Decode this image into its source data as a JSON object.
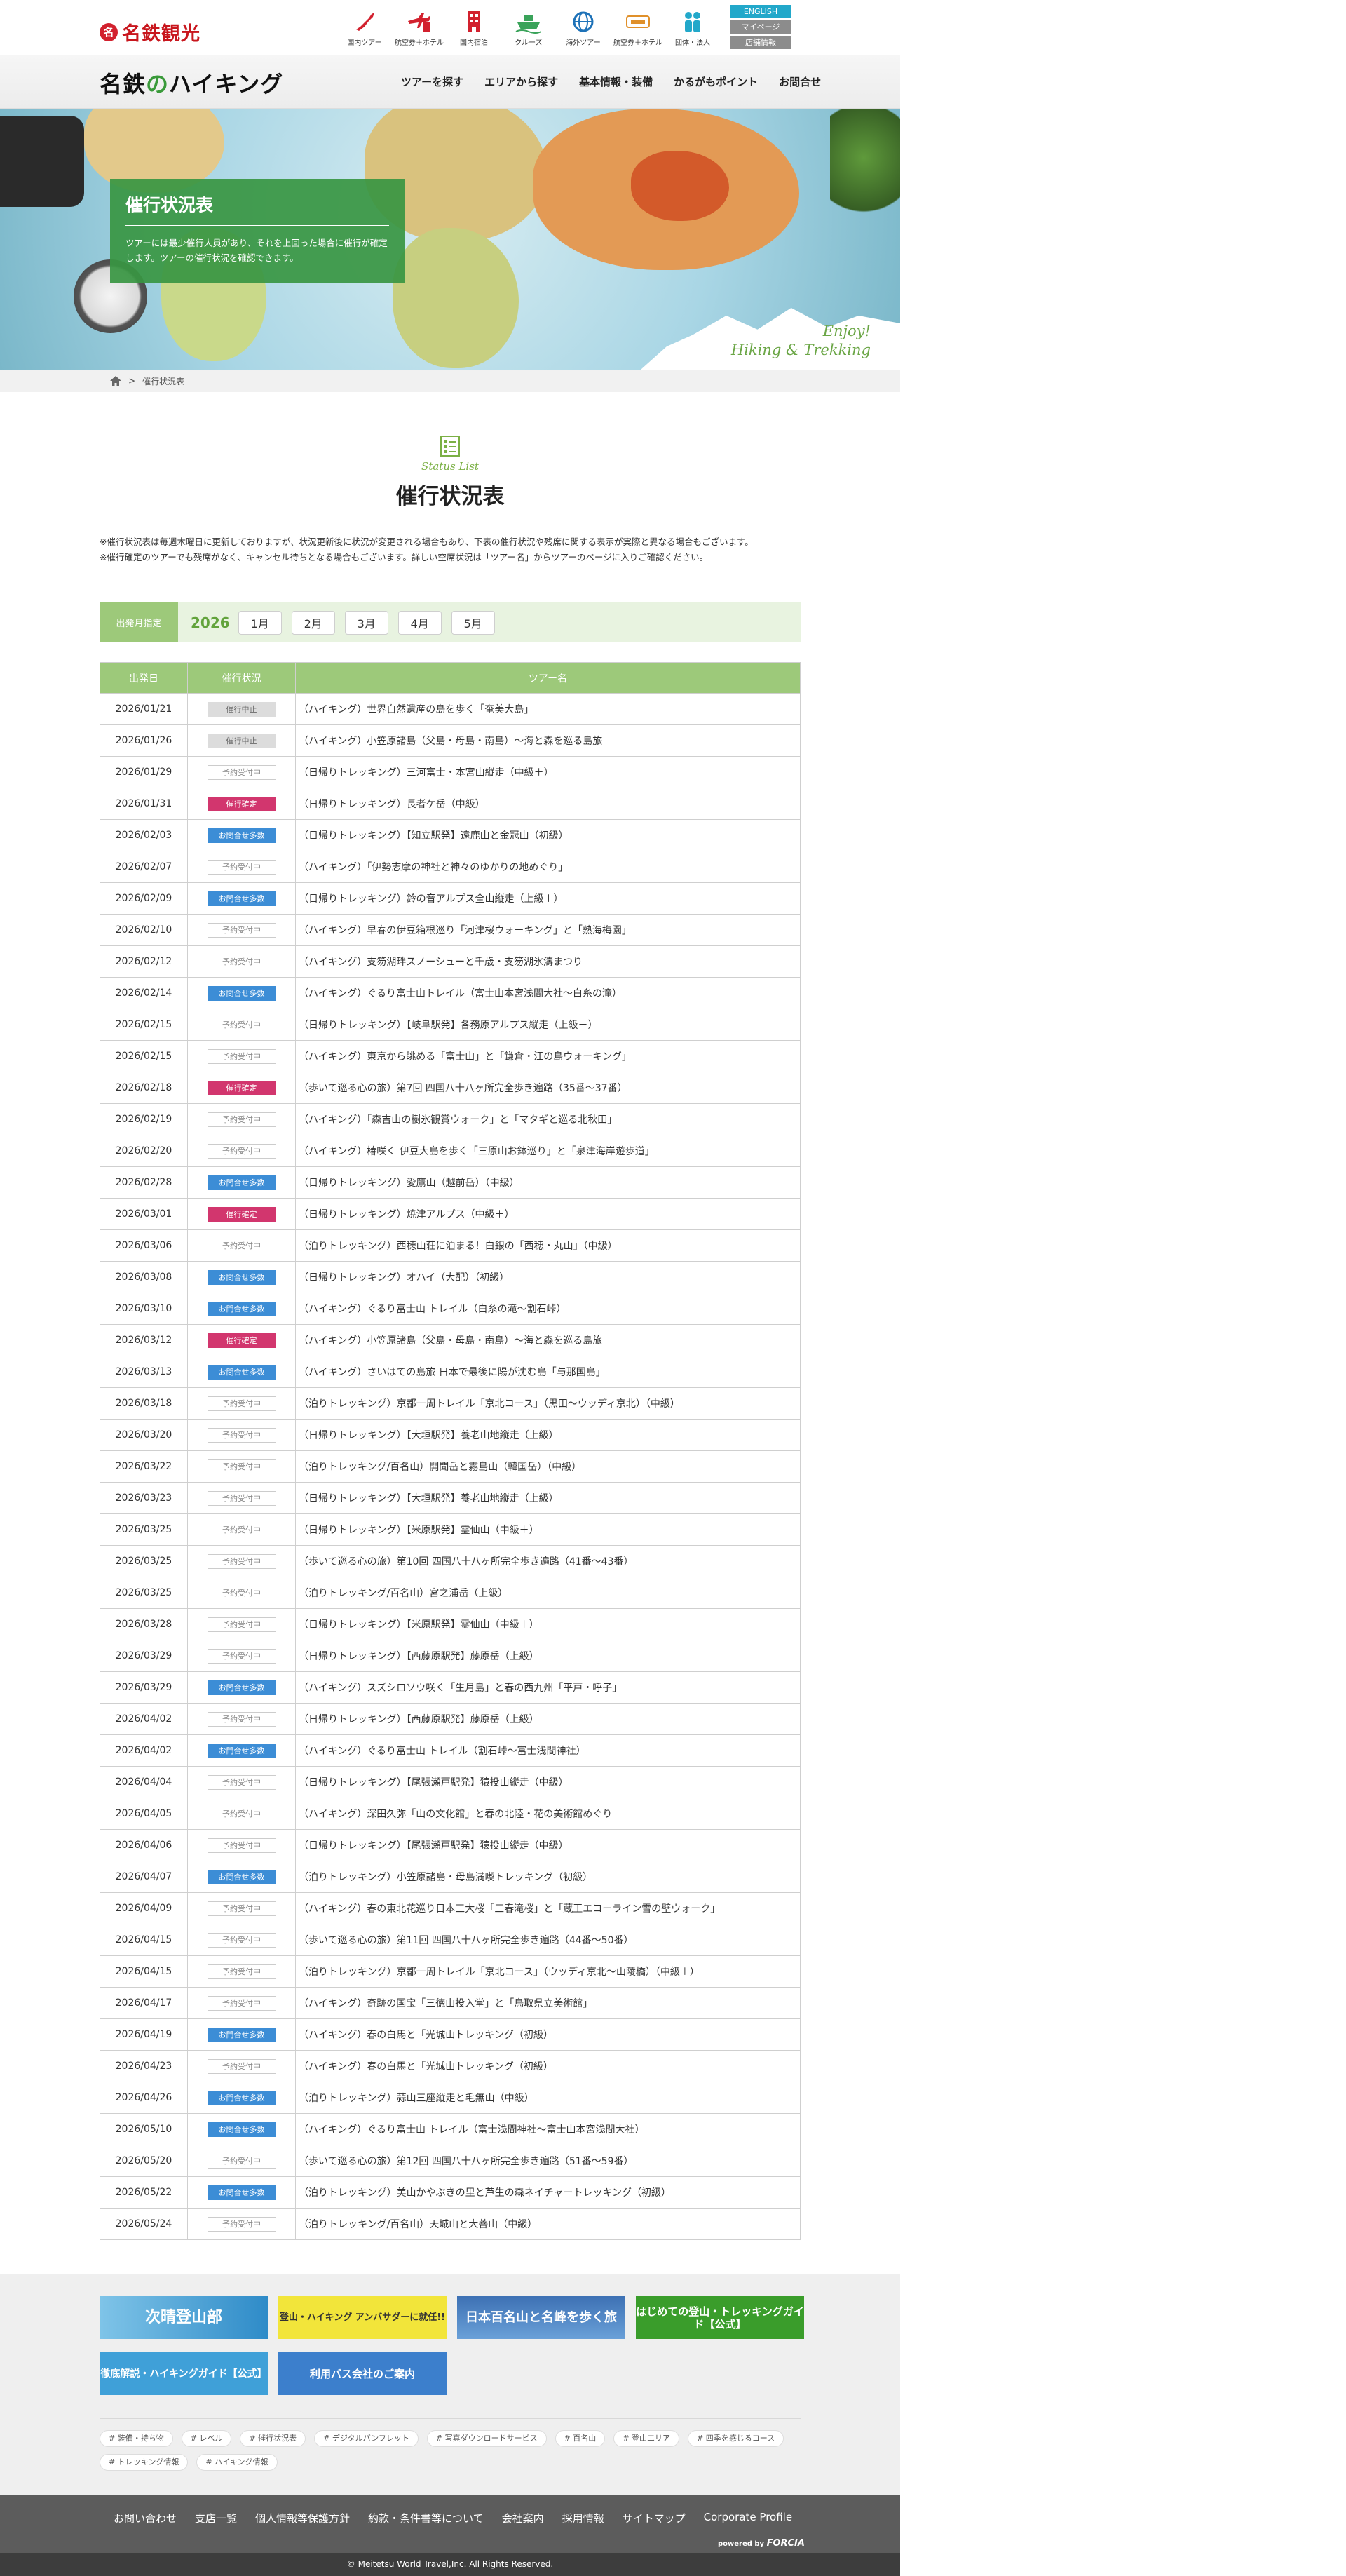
{
  "brand": {
    "mark": "名",
    "name": "名鉄観光"
  },
  "services": [
    {
      "label": "国内ツアー",
      "icon": "japan-map-icon"
    },
    {
      "label": "航空券＋ホテル",
      "icon": "plane-hotel-icon"
    },
    {
      "label": "国内宿泊",
      "icon": "building-icon"
    },
    {
      "label": "クルーズ",
      "icon": "ship-icon"
    },
    {
      "label": "海外ツアー",
      "icon": "globe-icon"
    },
    {
      "label": "航空券＋ホテル",
      "icon": "tabipad-icon"
    },
    {
      "label": "団体・法人",
      "icon": "group-icon"
    }
  ],
  "utility": {
    "english": "ENGLISH",
    "mypage": "マイページ",
    "stores": "店舗情報"
  },
  "site_logo": {
    "main": "名鉄",
    "kana": "の",
    "rest": "ハイキング"
  },
  "nav": [
    "ツアーを探す",
    "エリアから探す",
    "基本情報・装備",
    "かるがもポイント",
    "お問合せ"
  ],
  "hero": {
    "title": "催行状況表",
    "text": "ツアーには最少催行人員があり、それを上回った場合に催行が確定します。ツアーの催行状況を確認できます。",
    "tagline1": "Enjoy!",
    "tagline2": "Hiking & Trekking"
  },
  "breadcrumb": {
    "current": "催行状況表"
  },
  "section": {
    "en": "Status List",
    "title": "催行状況表"
  },
  "notes": [
    "※催行状況表は毎週木曜日に更新しておりますが、状況更新後に状況が変更される場合もあり、下表の催行状況や残席に関する表示が実際と異なる場合もございます。",
    "※催行確定のツアーでも残席がなく、キャンセル待ちとなる場合もございます。詳しい空席状況は「ツアー名」からツアーのページに入りご確認ください。"
  ],
  "filter": {
    "label": "出発月指定",
    "year": "2026",
    "months": [
      "1月",
      "2月",
      "3月",
      "4月",
      "5月"
    ]
  },
  "table": {
    "headers": [
      "出発日",
      "催行状況",
      "ツアー名"
    ],
    "rows": [
      {
        "date": "2026/01/21",
        "status": "催行中止",
        "type": "stop",
        "name": "（ハイキング）世界自然遺産の島を歩く「奄美大島」"
      },
      {
        "date": "2026/01/26",
        "status": "催行中止",
        "type": "stop",
        "name": "（ハイキング）小笠原諸島（父島・母島・南島）～海と森を巡る島旅"
      },
      {
        "date": "2026/01/29",
        "status": "予約受付中",
        "type": "open",
        "name": "（日帰りトレッキング）三河富士・本宮山縦走（中級＋）"
      },
      {
        "date": "2026/01/31",
        "status": "催行確定",
        "type": "confirm",
        "name": "（日帰りトレッキング）長者ケ岳（中級）"
      },
      {
        "date": "2026/02/03",
        "status": "お問合せ多数",
        "type": "inquiry",
        "name": "（日帰りトレッキング）【知立駅発】遠鹿山と金冠山（初級）"
      },
      {
        "date": "2026/02/07",
        "status": "予約受付中",
        "type": "open",
        "name": "（ハイキング）「伊勢志摩の神社と神々のゆかりの地めぐり」"
      },
      {
        "date": "2026/02/09",
        "status": "お問合せ多数",
        "type": "inquiry",
        "name": "（日帰りトレッキング）鈴の音アルプス全山縦走（上級＋）"
      },
      {
        "date": "2026/02/10",
        "status": "予約受付中",
        "type": "open",
        "name": "（ハイキング）早春の伊豆箱根巡り「河津桜ウォーキング」と「熱海梅園」"
      },
      {
        "date": "2026/02/12",
        "status": "予約受付中",
        "type": "open",
        "name": "（ハイキング）支笏湖畔スノーシューと千歳・支笏湖氷濤まつり"
      },
      {
        "date": "2026/02/14",
        "status": "お問合せ多数",
        "type": "inquiry",
        "name": "（ハイキング）ぐるり富士山トレイル（富士山本宮浅間大社～白糸の滝）"
      },
      {
        "date": "2026/02/15",
        "status": "予約受付中",
        "type": "open",
        "name": "（日帰りトレッキング）【岐阜駅発】各務原アルプス縦走（上級＋）"
      },
      {
        "date": "2026/02/15",
        "status": "予約受付中",
        "type": "open",
        "name": "（ハイキング）東京から眺める「富士山」と「鎌倉・江の島ウォーキング」"
      },
      {
        "date": "2026/02/18",
        "status": "催行確定",
        "type": "confirm",
        "name": "（歩いて巡る心の旅）第7回 四国八十八ヶ所完全歩き遍路（35番～37番）"
      },
      {
        "date": "2026/02/19",
        "status": "予約受付中",
        "type": "open",
        "name": "（ハイキング）「森吉山の樹氷観賞ウォーク」と「マタギと巡る北秋田」"
      },
      {
        "date": "2026/02/20",
        "status": "予約受付中",
        "type": "open",
        "name": "（ハイキング）椿咲く 伊豆大島を歩く「三原山お鉢巡り」と「泉津海岸遊歩道」"
      },
      {
        "date": "2026/02/28",
        "status": "お問合せ多数",
        "type": "inquiry",
        "name": "（日帰りトレッキング）愛鷹山（越前岳）（中級）"
      },
      {
        "date": "2026/03/01",
        "status": "催行確定",
        "type": "confirm",
        "name": "（日帰りトレッキング）焼津アルプス（中級＋）"
      },
      {
        "date": "2026/03/06",
        "status": "予約受付中",
        "type": "open",
        "name": "（泊りトレッキング）西穂山荘に泊まる！白銀の「西穂・丸山」（中級）"
      },
      {
        "date": "2026/03/08",
        "status": "お問合せ多数",
        "type": "inquiry",
        "name": "（日帰りトレッキング）オハイ（大配）（初級）"
      },
      {
        "date": "2026/03/10",
        "status": "お問合せ多数",
        "type": "inquiry",
        "name": "（ハイキング）ぐるり富士山 トレイル（白糸の滝～割石峠）"
      },
      {
        "date": "2026/03/12",
        "status": "催行確定",
        "type": "confirm",
        "name": "（ハイキング）小笠原諸島（父島・母島・南島）～海と森を巡る島旅"
      },
      {
        "date": "2026/03/13",
        "status": "お問合せ多数",
        "type": "inquiry",
        "name": "（ハイキング）さいはての島旅 日本で最後に陽が沈む島「与那国島」"
      },
      {
        "date": "2026/03/18",
        "status": "予約受付中",
        "type": "open",
        "name": "（泊りトレッキング）京都一周トレイル「京北コース」（黒田～ウッディ京北）（中級）"
      },
      {
        "date": "2026/03/20",
        "status": "予約受付中",
        "type": "open",
        "name": "（日帰りトレッキング）【大垣駅発】養老山地縦走（上級）"
      },
      {
        "date": "2026/03/22",
        "status": "予約受付中",
        "type": "open",
        "name": "（泊りトレッキング/百名山）開聞岳と霧島山（韓国岳）（中級）"
      },
      {
        "date": "2026/03/23",
        "status": "予約受付中",
        "type": "open",
        "name": "（日帰りトレッキング）【大垣駅発】養老山地縦走（上級）"
      },
      {
        "date": "2026/03/25",
        "status": "予約受付中",
        "type": "open",
        "name": "（日帰りトレッキング）【米原駅発】霊仙山（中級＋）"
      },
      {
        "date": "2026/03/25",
        "status": "予約受付中",
        "type": "open",
        "name": "（歩いて巡る心の旅）第10回 四国八十八ヶ所完全歩き遍路（41番～43番）"
      },
      {
        "date": "2026/03/25",
        "status": "予約受付中",
        "type": "open",
        "name": "（泊りトレッキング/百名山）宮之浦岳（上級）"
      },
      {
        "date": "2026/03/28",
        "status": "予約受付中",
        "type": "open",
        "name": "（日帰りトレッキング）【米原駅発】霊仙山（中級＋）"
      },
      {
        "date": "2026/03/29",
        "status": "予約受付中",
        "type": "open",
        "name": "（日帰りトレッキング）【西藤原駅発】藤原岳（上級）"
      },
      {
        "date": "2026/03/29",
        "status": "お問合せ多数",
        "type": "inquiry",
        "name": "（ハイキング）スズシロソウ咲く「生月島」と春の西九州「平戸・呼子」"
      },
      {
        "date": "2026/04/02",
        "status": "予約受付中",
        "type": "open",
        "name": "（日帰りトレッキング）【西藤原駅発】藤原岳（上級）"
      },
      {
        "date": "2026/04/02",
        "status": "お問合せ多数",
        "type": "inquiry",
        "name": "（ハイキング）ぐるり富士山 トレイル（割石峠～富士浅間神社）"
      },
      {
        "date": "2026/04/04",
        "status": "予約受付中",
        "type": "open",
        "name": "（日帰りトレッキング）【尾張瀬戸駅発】猿投山縦走（中級）"
      },
      {
        "date": "2026/04/05",
        "status": "予約受付中",
        "type": "open",
        "name": "（ハイキング）深田久弥「山の文化館」と春の北陸・花の美術館めぐり"
      },
      {
        "date": "2026/04/06",
        "status": "予約受付中",
        "type": "open",
        "name": "（日帰りトレッキング）【尾張瀬戸駅発】猿投山縦走（中級）"
      },
      {
        "date": "2026/04/07",
        "status": "お問合せ多数",
        "type": "inquiry",
        "name": "（泊りトレッキング）小笠原諸島・母島満喫トレッキング（初級）"
      },
      {
        "date": "2026/04/09",
        "status": "予約受付中",
        "type": "open",
        "name": "（ハイキング）春の東北花巡り日本三大桜「三春滝桜」と「蔵王エコーライン雪の壁ウォーク」"
      },
      {
        "date": "2026/04/15",
        "status": "予約受付中",
        "type": "open",
        "name": "（歩いて巡る心の旅）第11回 四国八十八ヶ所完全歩き遍路（44番～50番）"
      },
      {
        "date": "2026/04/15",
        "status": "予約受付中",
        "type": "open",
        "name": "（泊りトレッキング）京都一周トレイル「京北コース」（ウッディ京北～山陵橋）（中級＋）"
      },
      {
        "date": "2026/04/17",
        "status": "予約受付中",
        "type": "open",
        "name": "（ハイキング）奇跡の国宝「三徳山投入堂」と「鳥取県立美術館」"
      },
      {
        "date": "2026/04/19",
        "status": "お問合せ多数",
        "type": "inquiry",
        "name": "（ハイキング）春の白馬と「光城山トレッキング（初級）"
      },
      {
        "date": "2026/04/23",
        "status": "予約受付中",
        "type": "open",
        "name": "（ハイキング）春の白馬と「光城山トレッキング（初級）"
      },
      {
        "date": "2026/04/26",
        "status": "お問合せ多数",
        "type": "inquiry",
        "name": "（泊りトレッキング）蒜山三座縦走と毛無山（中級）"
      },
      {
        "date": "2026/05/10",
        "status": "お問合せ多数",
        "type": "inquiry",
        "name": "（ハイキング）ぐるり富士山 トレイル（富士浅間神社～富士山本宮浅間大社）"
      },
      {
        "date": "2026/05/20",
        "status": "予約受付中",
        "type": "open",
        "name": "（歩いて巡る心の旅）第12回 四国八十八ヶ所完全歩き遍路（51番～59番）"
      },
      {
        "date": "2026/05/22",
        "status": "お問合せ多数",
        "type": "inquiry",
        "name": "（泊りトレッキング）美山かやぶきの里と芦生の森ネイチャートレッキング（初級）"
      },
      {
        "date": "2026/05/24",
        "status": "予約受付中",
        "type": "open",
        "name": "（泊りトレッキング/百名山）天城山と大菩山（中級）"
      }
    ]
  },
  "banners": [
    {
      "label": "次晴登山部"
    },
    {
      "label": "登山・ハイキング アンバサダーに就任!!"
    },
    {
      "label": "日本百名山と名峰を歩く旅"
    },
    {
      "label": "はじめての登山・トレッキングガイド【公式】"
    },
    {
      "label": "徹底解説・ハイキングガイド【公式】"
    },
    {
      "label": "利用バス会社のご案内"
    }
  ],
  "tags": [
    "装備・持ち物",
    "レベル",
    "催行状況表",
    "デジタルパンフレット",
    "写真ダウンロードサービス",
    "百名山",
    "登山エリア",
    "四季を感じるコース",
    "トレッキング情報",
    "ハイキング情報"
  ],
  "footer_links": [
    "お問い合わせ",
    "支店一覧",
    "個人情報等保護方針",
    "約款・条件書等について",
    "会社案内",
    "採用情報",
    "サイトマップ",
    "Corporate Profile"
  ],
  "powered": {
    "prefix": "powered by",
    "name": "FORCIA"
  },
  "copyright": "© Meitetsu World Travel,Inc. All Rights Reserved."
}
